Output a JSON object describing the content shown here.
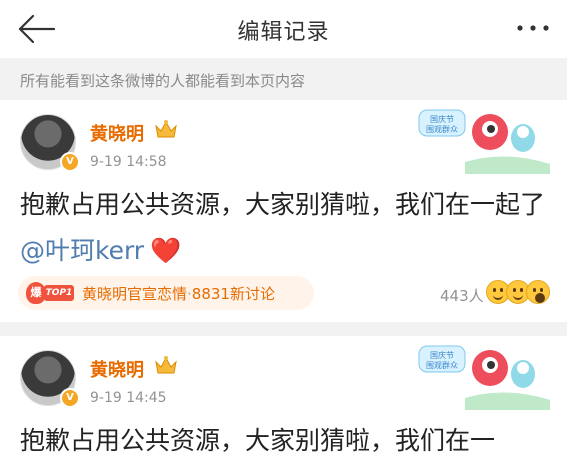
{
  "header": {
    "title": "编辑记录"
  },
  "notice": "所有能看到这条微博的人都能看到本页内容",
  "posts": [
    {
      "author": "黄晓明",
      "time": "9-19 14:58",
      "text_before": "抱歉占用公共资源，大家别猜啦，我们在一起了",
      "mention": "@叶珂kerr",
      "heart": "❤️",
      "topic": {
        "badge": "爆",
        "rank": "TOP1",
        "label": "黄晓明官宣恋情",
        "separator": "·",
        "discussion": "8831新讨论"
      },
      "stats": "443人"
    },
    {
      "author": "黄晓明",
      "time": "9-19 14:45",
      "text_before": "抱歉占用公共资源，大家别猜啦，我们在一"
    }
  ],
  "colors": {
    "author": "#e86b00",
    "mention": "#507daf",
    "muted": "#939393",
    "badge": "#f0533d"
  },
  "icons": {
    "back": "arrow-left-icon",
    "more": "more-dots-icon",
    "crown": "crown-icon",
    "verified": "verified-badge-icon"
  }
}
